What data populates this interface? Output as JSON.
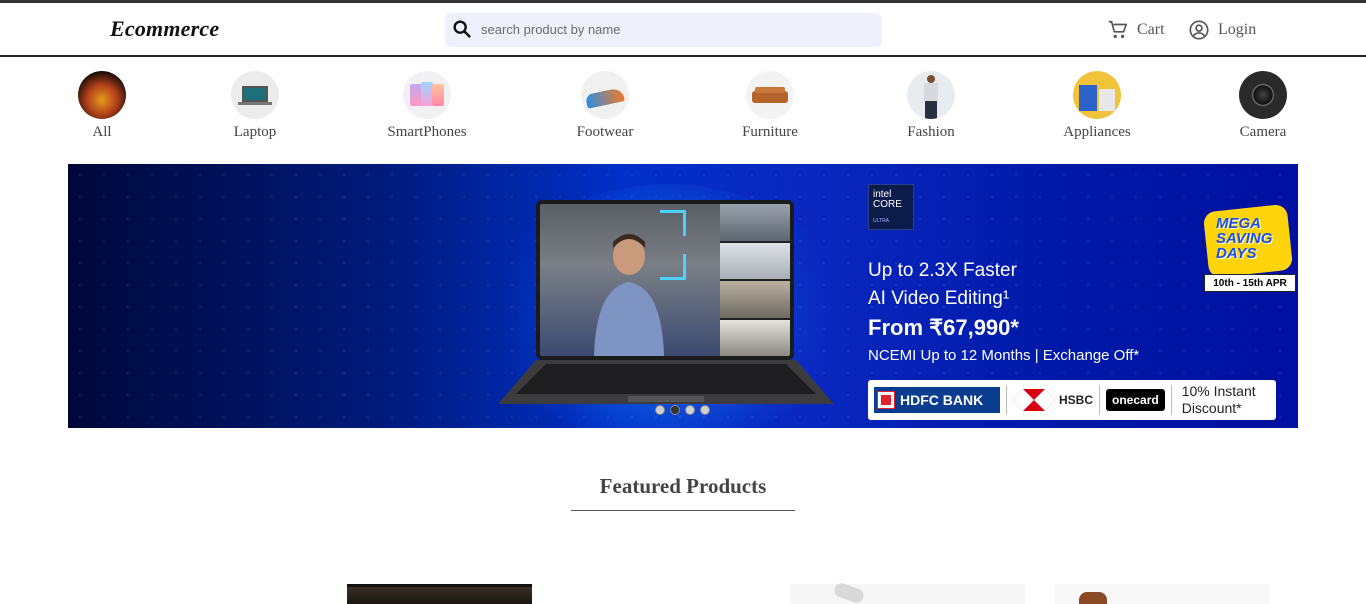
{
  "header": {
    "logo": "Ecommerce",
    "search_placeholder": "search product by name",
    "cart_label": "Cart",
    "login_label": "Login"
  },
  "categories": [
    {
      "label": "All",
      "icon": "all-products-thumbnail"
    },
    {
      "label": "Laptop",
      "icon": "laptop-thumbnail"
    },
    {
      "label": "SmartPhones",
      "icon": "smartphones-thumbnail"
    },
    {
      "label": "Footwear",
      "icon": "shoe-thumbnail"
    },
    {
      "label": "Furniture",
      "icon": "sofa-thumbnail"
    },
    {
      "label": "Fashion",
      "icon": "fashion-model-thumbnail"
    },
    {
      "label": "Appliances",
      "icon": "appliances-thumbnail"
    },
    {
      "label": "Camera",
      "icon": "camera-thumbnail"
    }
  ],
  "banner": {
    "intel_badge": "intel CORE",
    "intel_sub": "ULTRA",
    "line1": "Up to 2.3X Faster",
    "line2": "AI Video Editing¹",
    "line3": "From ₹67,990*",
    "line4": "NCEMI Up to 12 Months | Exchange Off*",
    "bank1": "HDFC BANK",
    "bank2": "HSBC",
    "bank3": "onecard",
    "discount_line1": "10% Instant",
    "discount_line2": "Discount*",
    "mega_line1": "MEGA",
    "mega_line2": "SAVING",
    "mega_line3": "DAYS",
    "mega_dates": "10th - 15th APR",
    "slide_count": 4,
    "active_slide": 2
  },
  "featured": {
    "title": "Featured Products"
  },
  "colors": {
    "search_bg": "#eef1fb",
    "banner_blue": "#0030c8",
    "header_border": "#222222"
  }
}
